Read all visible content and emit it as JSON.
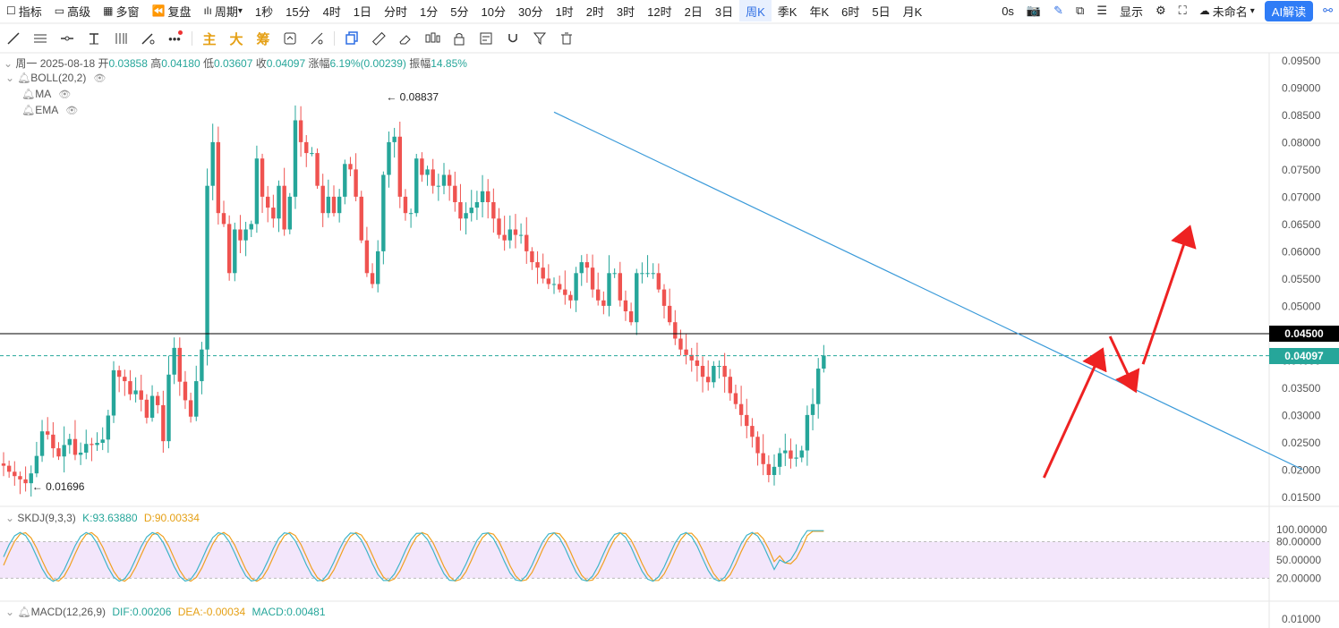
{
  "toolbar": {
    "items": [
      "指标",
      "高级",
      "多窗",
      "复盘",
      "周期",
      "1秒",
      "15分",
      "4时",
      "1日",
      "分时",
      "1分",
      "5分",
      "10分",
      "30分",
      "1时",
      "2时",
      "3时",
      "12时",
      "2日",
      "3日",
      "周K",
      "季K",
      "年K",
      "6时",
      "5日",
      "月K"
    ],
    "active": "周K",
    "right_time": "0s",
    "display_label": "显示",
    "cloud_label": "未命名",
    "ai_label": "AI解读"
  },
  "drawing_tools": {
    "text_tools": [
      "主",
      "大",
      "筹"
    ]
  },
  "info": {
    "date": "周一 2025-08-18",
    "open_label": "开",
    "open": "0.03858",
    "high_label": "高",
    "high": "0.04180",
    "low_label": "低",
    "low": "0.03607",
    "close_label": "收",
    "close": "0.04097",
    "change_label": "涨幅",
    "change": "6.19%(0.00239)",
    "amp_label": "振幅",
    "amp": "14.85%"
  },
  "indicators": [
    "BOLL(20,2)",
    "MA",
    "EMA"
  ],
  "skdj": {
    "name": "SKDJ(9,3,3)",
    "k": "K:93.63880",
    "d": "D:90.00334"
  },
  "macd": {
    "name": "MACD(12,26,9)",
    "dif": "DIF:0.00206",
    "dea": "DEA:-0.00034",
    "macd": "MACD:0.00481"
  },
  "colors": {
    "up": "#26a69a",
    "down": "#ef5350",
    "trend": "#3a9ad9",
    "arrow": "#ee2222",
    "k_line": "#3fb5c9",
    "d_line": "#f0a020",
    "band": "#f3e6fb"
  },
  "chart_data": {
    "type": "candlestick",
    "timeframe": "周K",
    "ylim": [
      0.015,
      0.095
    ],
    "y_ticks": [
      "0.09500",
      "0.09000",
      "0.08500",
      "0.08000",
      "0.07500",
      "0.07000",
      "0.06500",
      "0.06000",
      "0.05500",
      "0.05000",
      "0.04500",
      "0.04000",
      "0.03500",
      "0.03000",
      "0.02500",
      "0.02000",
      "0.01500"
    ],
    "high_marker": "0.08837",
    "low_marker": "0.01696",
    "hline": {
      "value": 0.045,
      "label": "0.04500"
    },
    "last_price": {
      "value": 0.04097,
      "label": "0.04097"
    },
    "closes": [
      0.0208,
      0.0197,
      0.0189,
      0.0183,
      0.0176,
      0.0194,
      0.0226,
      0.0271,
      0.0265,
      0.024,
      0.0225,
      0.0246,
      0.0257,
      0.0228,
      0.0232,
      0.0248,
      0.0246,
      0.025,
      0.0256,
      0.03,
      0.0383,
      0.0371,
      0.0363,
      0.0339,
      0.0346,
      0.0329,
      0.0296,
      0.0336,
      0.0319,
      0.0253,
      0.0375,
      0.0424,
      0.0362,
      0.0328,
      0.0298,
      0.0363,
      0.0421,
      0.0721,
      0.0801,
      0.0671,
      0.0651,
      0.0561,
      0.0641,
      0.0621,
      0.0641,
      0.0651,
      0.0771,
      0.0701,
      0.0681,
      0.0661,
      0.0721,
      0.0641,
      0.0701,
      0.0841,
      0.0801,
      0.0781,
      0.0781,
      0.0721,
      0.0671,
      0.0701,
      0.0671,
      0.0701,
      0.0761,
      0.0751,
      0.0701,
      0.0621,
      0.0561,
      0.0541,
      0.0601,
      0.0741,
      0.0801,
      0.0811,
      0.0701,
      0.0671,
      0.0671,
      0.0771,
      0.0741,
      0.0751,
      0.0721,
      0.0721,
      0.0741,
      0.0721,
      0.0691,
      0.0661,
      0.0671,
      0.0681,
      0.0691,
      0.0711,
      0.0691,
      0.0661,
      0.0631,
      0.0621,
      0.0641,
      0.0631,
      0.0631,
      0.0601,
      0.0581,
      0.0571,
      0.0551,
      0.0541,
      0.0541,
      0.0531,
      0.0521,
      0.0511,
      0.0561,
      0.0581,
      0.0571,
      0.0531,
      0.0511,
      0.0501,
      0.0561,
      0.0561,
      0.0511,
      0.0491,
      0.0471,
      0.0561,
      0.0561,
      0.0561,
      0.0561,
      0.0531,
      0.0501,
      0.0471,
      0.0441,
      0.0421,
      0.0411,
      0.0401,
      0.0391,
      0.0371,
      0.0361,
      0.0391,
      0.0391,
      0.0371,
      0.0341,
      0.0321,
      0.0301,
      0.0281,
      0.0261,
      0.0231,
      0.0211,
      0.0191,
      0.0206,
      0.0231,
      0.0236,
      0.0221,
      0.0223,
      0.0236,
      0.0301,
      0.0321,
      0.0386,
      0.041
    ],
    "trendline": [
      [
        100,
        0.0856
      ],
      [
        236,
        0.0201
      ]
    ],
    "annotation_arrows": [
      {
        "from": [
          189,
          0.0186
        ],
        "to": [
          199,
          0.0407
        ]
      },
      {
        "from": [
          201,
          0.0445
        ],
        "to": [
          205,
          0.0359
        ]
      },
      {
        "from": [
          207,
          0.0394
        ],
        "to": [
          215,
          0.0631
        ]
      }
    ],
    "skdj": {
      "ylim": [
        0,
        110
      ],
      "ticks": [
        "100.00000",
        "80.00000",
        "50.00000",
        "20.00000"
      ],
      "band": [
        20,
        80
      ]
    },
    "macd_ticks": [
      "0.01000"
    ]
  }
}
